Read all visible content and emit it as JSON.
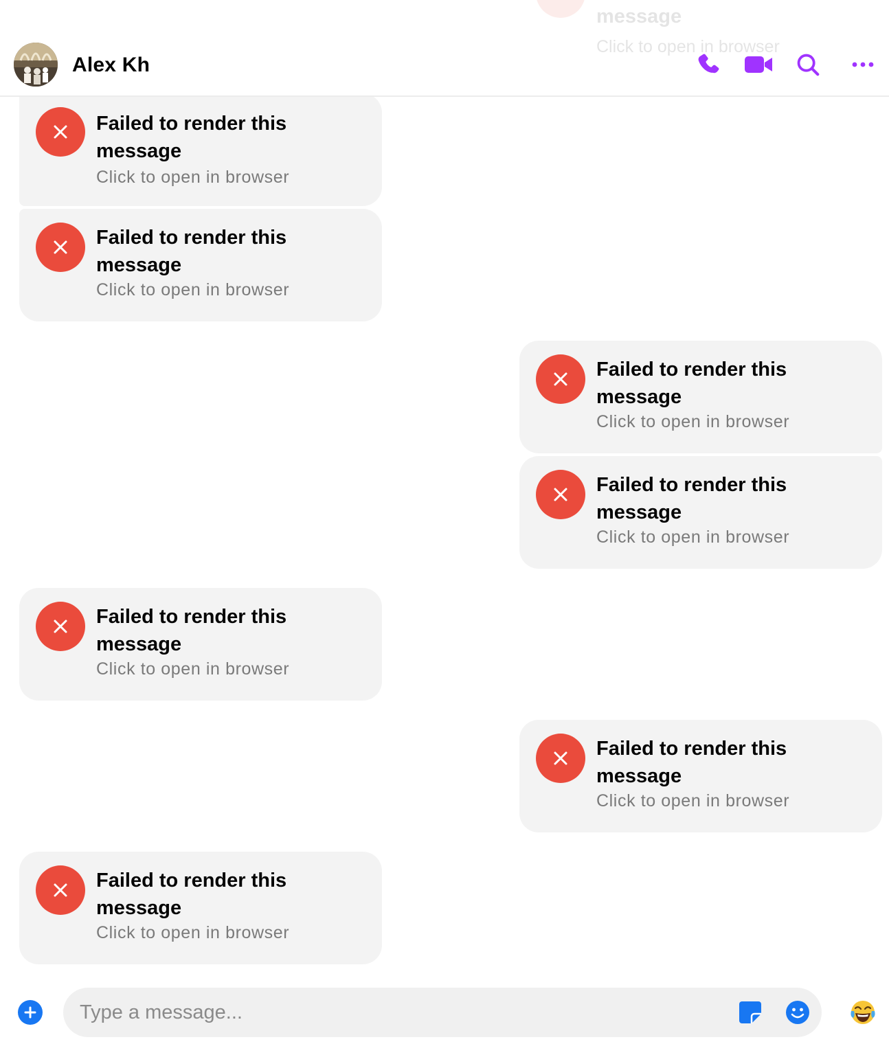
{
  "colors": {
    "accent": "#a033ff",
    "error": "#ea4b3c",
    "bubble": "#f3f3f3",
    "composer_blue": "#1877f2"
  },
  "header": {
    "contact_name": "Alex Kh",
    "actions": [
      "phone-icon",
      "video-camera-icon",
      "search-icon",
      "more-icon"
    ]
  },
  "messages": [
    {
      "side": "left",
      "title": "Failed to render this message",
      "subtitle": "Click to open in browser"
    },
    {
      "side": "left",
      "title": "Failed to render this message",
      "subtitle": "Click to open in browser"
    },
    {
      "side": "right",
      "title": "Failed to render this message",
      "subtitle": "Click to open in browser"
    },
    {
      "side": "right",
      "title": "Failed to render this message",
      "subtitle": "Click to open in browser"
    },
    {
      "side": "left",
      "title": "Failed to render this message",
      "subtitle": "Click to open in browser"
    },
    {
      "side": "right",
      "title": "Failed to render this message",
      "subtitle": "Click to open in browser"
    },
    {
      "side": "left",
      "title": "Failed to render this message",
      "subtitle": "Click to open in browser"
    }
  ],
  "ghost_message": {
    "title": "message",
    "subtitle": "Click to open in browser"
  },
  "composer": {
    "placeholder": "Type a message...",
    "icons": [
      "plus-icon",
      "sticker-icon",
      "emoji-icon",
      "laughing-emoji-icon"
    ]
  }
}
